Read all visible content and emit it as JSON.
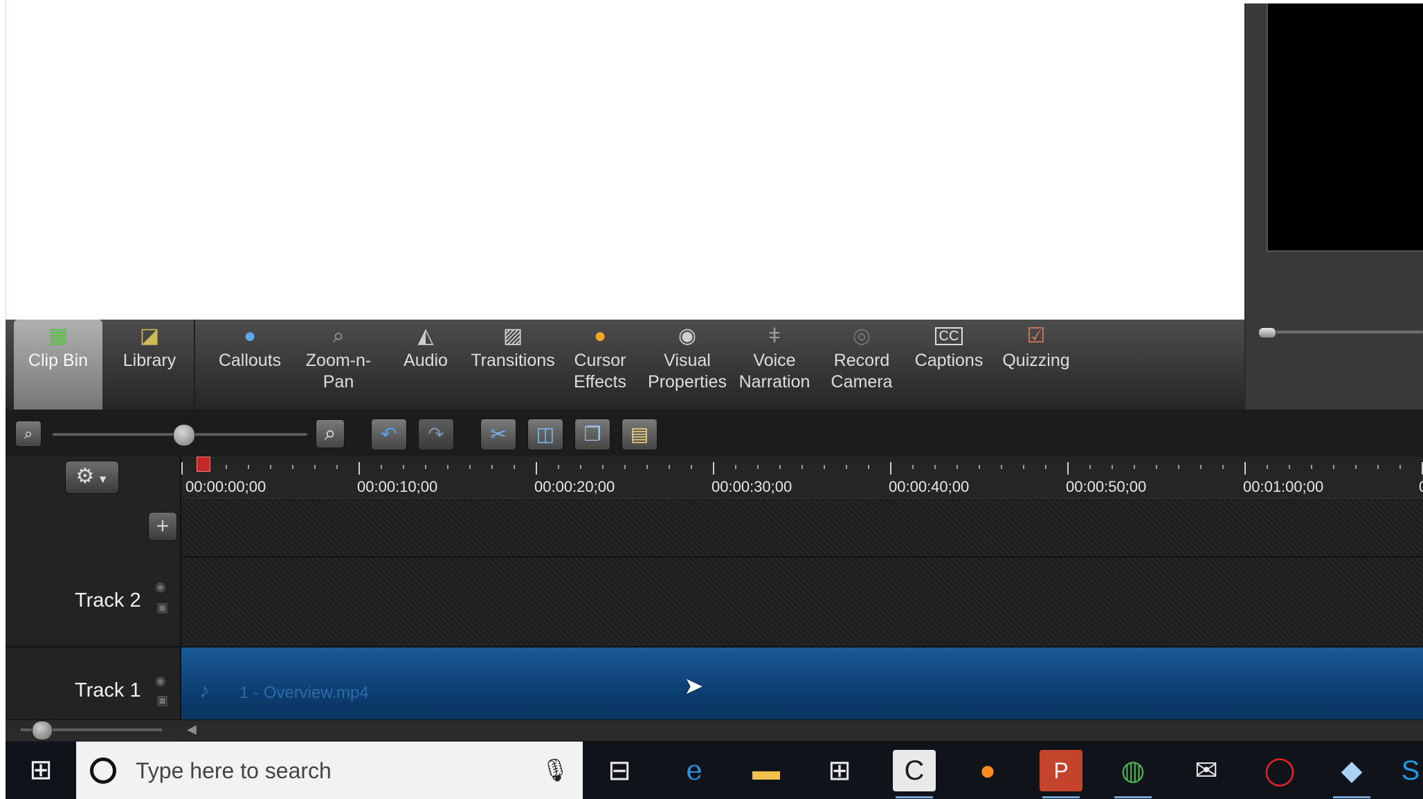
{
  "tools": [
    {
      "id": "clip-bin",
      "label": "Clip Bin",
      "icon": "film-icon",
      "active": true
    },
    {
      "id": "library",
      "label": "Library",
      "icon": "library-icon"
    },
    {
      "id": "callouts",
      "label": "Callouts",
      "icon": "speech-bubble-icon"
    },
    {
      "id": "zoom-n-pan",
      "label": "Zoom-n-\nPan",
      "icon": "magnifier-icon"
    },
    {
      "id": "audio",
      "label": "Audio",
      "icon": "speaker-icon"
    },
    {
      "id": "transitions",
      "label": "Transitions",
      "icon": "transition-icon"
    },
    {
      "id": "cursor-effects",
      "label": "Cursor\nEffects",
      "icon": "cursor-icon"
    },
    {
      "id": "visual-properties",
      "label": "Visual\nProperties",
      "icon": "film-reel-icon"
    },
    {
      "id": "voice-narration",
      "label": "Voice\nNarration",
      "icon": "microphone-icon"
    },
    {
      "id": "record-camera",
      "label": "Record\nCamera",
      "icon": "webcam-icon"
    },
    {
      "id": "captions",
      "label": "Captions",
      "icon": "cc-icon"
    },
    {
      "id": "quizzing",
      "label": "Quizzing",
      "icon": "quiz-icon"
    }
  ],
  "timeline": {
    "ruler": [
      "00:00:00;00",
      "00:00:10;00",
      "00:00:20;00",
      "00:00:30;00",
      "00:00:40;00",
      "00:00:50;00",
      "00:01:00;00"
    ],
    "ruler_cut": "0",
    "tracks": [
      {
        "name": "Track 2"
      },
      {
        "name": "Track 1"
      }
    ],
    "clip": "1 - Overview.mp4",
    "timeline_zoom_level": 0.45
  },
  "taskbar": {
    "search_placeholder": "Type here to search",
    "apps": [
      "task-view-icon",
      "edge-icon",
      "file-explorer-icon",
      "store-icon",
      "camtasia-icon",
      "firefox-icon",
      "powerpoint-icon",
      "chrome-icon",
      "mail-icon",
      "opera-icon",
      "notepad-icon",
      "skype-icon"
    ]
  },
  "colors": {
    "clip_blue": "#1a5a95",
    "playhead": "#c62828",
    "active_tool": "#9c9c9c"
  }
}
